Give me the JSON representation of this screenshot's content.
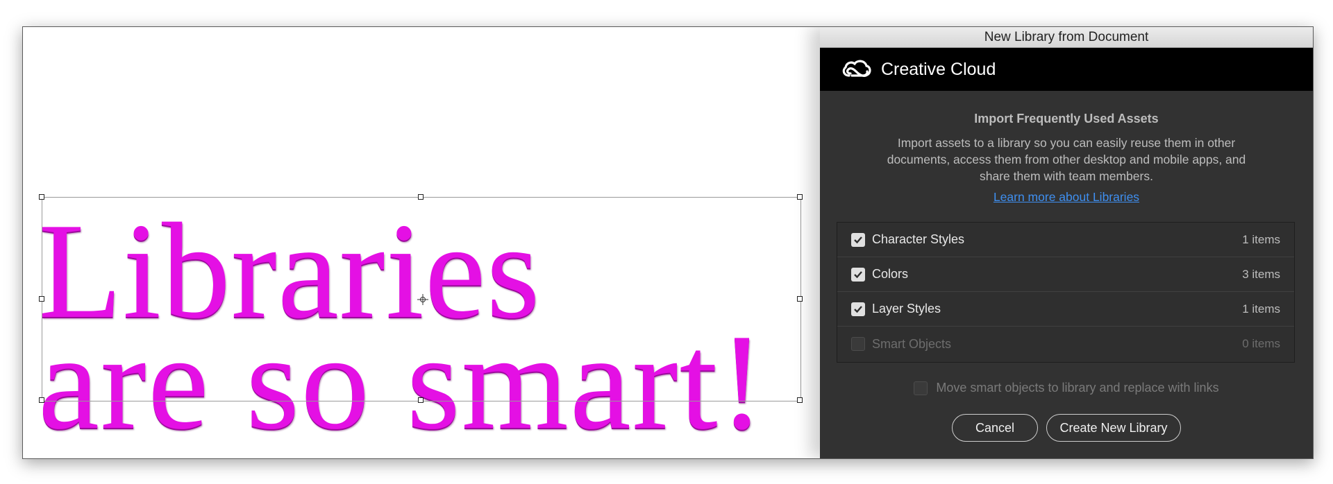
{
  "dialog": {
    "title": "New Library from Document",
    "brand": "Creative Cloud",
    "heading": "Import Frequently Used Assets",
    "description": "Import assets to a library so you can easily reuse them in other documents, access them from other desktop and mobile apps, and share them with team members.",
    "learn_more_link": "Learn more about Libraries",
    "assets": [
      {
        "label": "Character Styles",
        "count": "1 items",
        "checked": true,
        "enabled": true
      },
      {
        "label": "Colors",
        "count": "3 items",
        "checked": true,
        "enabled": true
      },
      {
        "label": "Layer Styles",
        "count": "1 items",
        "checked": true,
        "enabled": true
      },
      {
        "label": "Smart Objects",
        "count": "0 items",
        "checked": false,
        "enabled": false
      }
    ],
    "move_smart_objects_label": "Move smart objects to library and replace with links",
    "move_smart_objects_checked": false,
    "cancel_label": "Cancel",
    "create_label": "Create New Library"
  },
  "canvas": {
    "text_line1": "Libraries",
    "text_line2": "are so smart!",
    "text_color": "#e410e4"
  },
  "colors": {
    "dialog_bg": "#323232",
    "header_bg": "#000000",
    "link": "#3f8ff0"
  }
}
